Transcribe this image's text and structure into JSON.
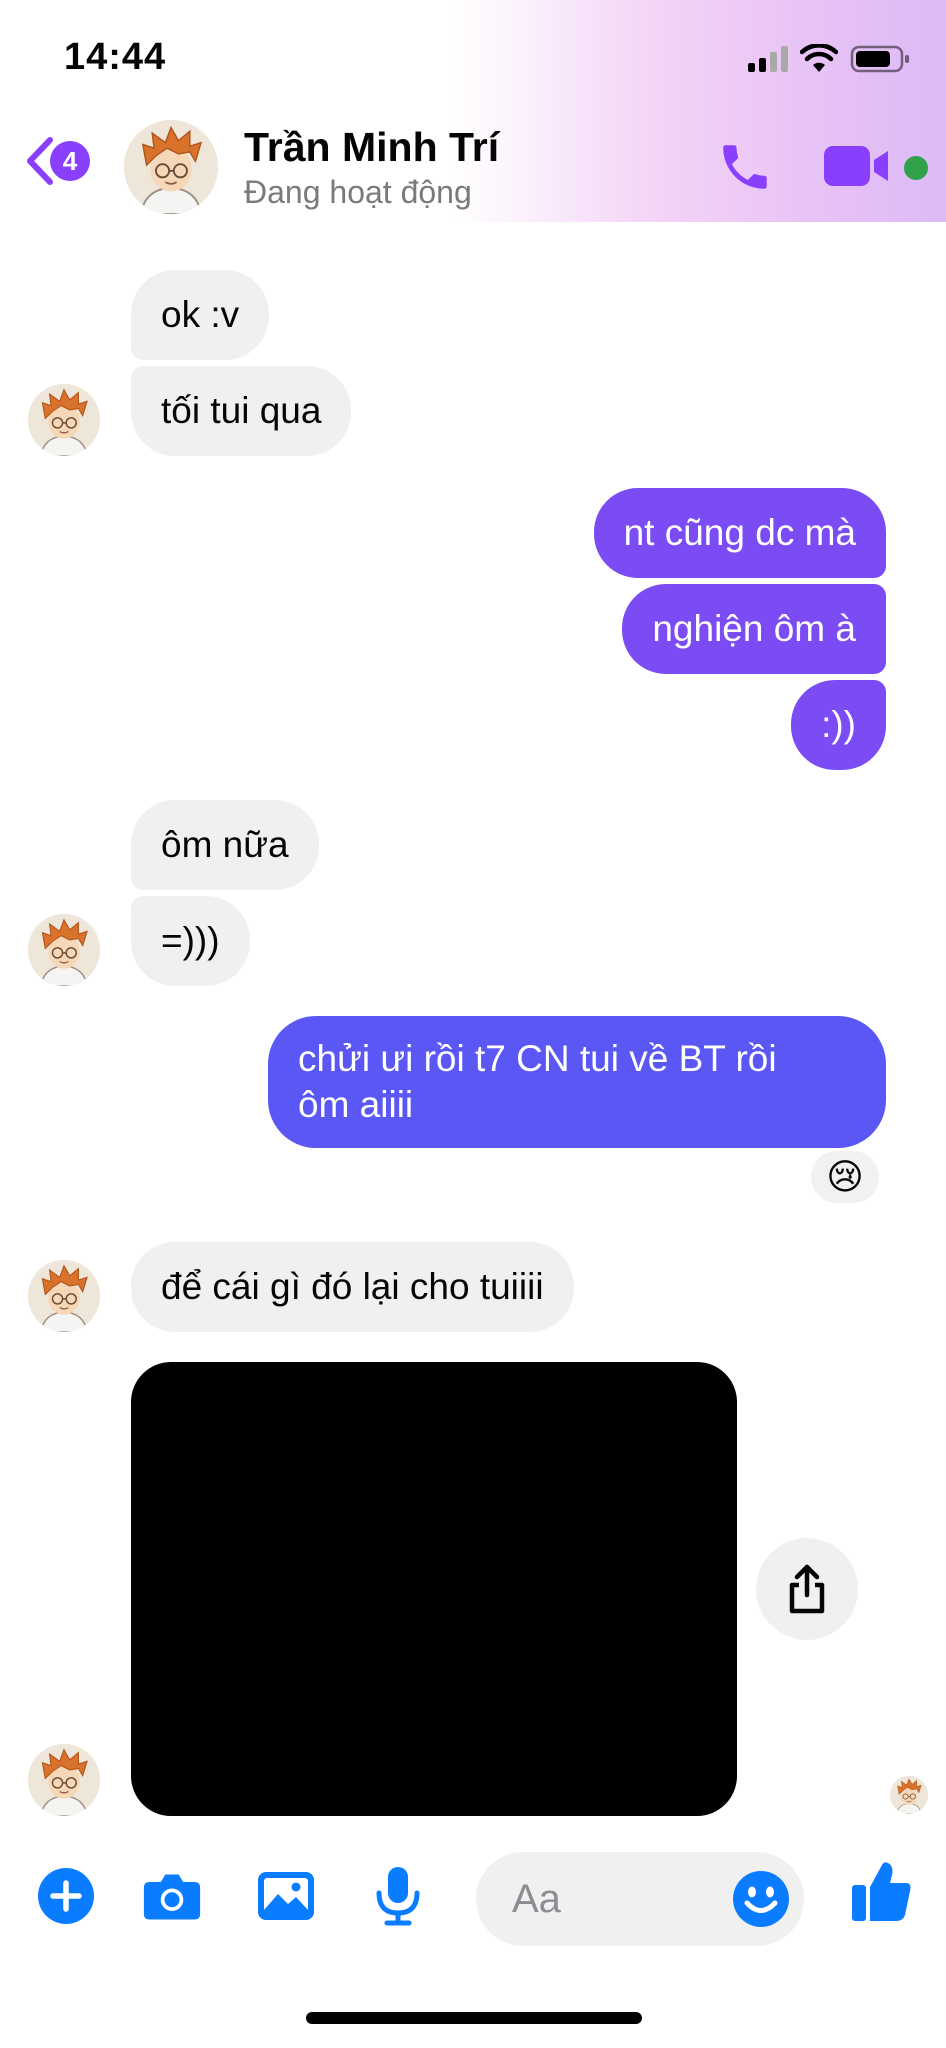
{
  "status_bar": {
    "time": "14:44"
  },
  "header": {
    "back_badge": "4",
    "contact_name": "Trần Minh Trí",
    "contact_status": "Đang hoạt động"
  },
  "messages": [
    {
      "side": "in",
      "text": "ok :v"
    },
    {
      "side": "in",
      "text": "tối tui qua"
    },
    {
      "side": "out",
      "text": "nt cũng dc mà"
    },
    {
      "side": "out",
      "text": "nghiện ôm à"
    },
    {
      "side": "out",
      "text": ":))"
    },
    {
      "side": "in",
      "text": "ôm nữa"
    },
    {
      "side": "in",
      "text": "=)))"
    },
    {
      "side": "out",
      "text_line1": "chửi ưi rồi t7 CN tui về BT rồi",
      "text_line2": "ôm aiiii",
      "reaction": "😢"
    },
    {
      "side": "in",
      "text": "để cái gì đó lại cho tuiiii"
    }
  ],
  "composer": {
    "placeholder": "Aa"
  },
  "colors": {
    "accent": "#8a3ffc",
    "outgoing_bubble": "#7b4cf3",
    "outgoing_bubble_alt": "#5a57f4",
    "incoming_bubble": "#f0f0f0",
    "composer_icon": "#0a7cff",
    "online": "#31a24c"
  },
  "icons": {
    "back": "chevron-left-icon",
    "call": "phone-icon",
    "video": "video-camera-icon",
    "share": "share-icon",
    "plus": "plus-circle-icon",
    "camera": "camera-icon",
    "gallery": "image-icon",
    "mic": "microphone-icon",
    "emoji": "smiley-icon",
    "like": "thumbs-up-icon"
  }
}
